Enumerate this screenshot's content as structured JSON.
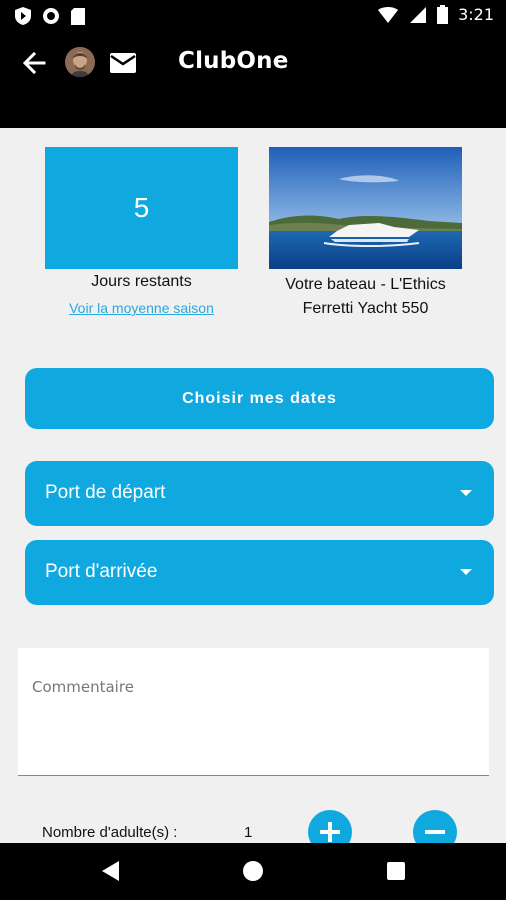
{
  "status_bar": {
    "time": "3:21",
    "icons": [
      "shield-app-icon",
      "record-icon",
      "sd-card-icon",
      "wifi-icon",
      "signal-icon",
      "battery-icon"
    ]
  },
  "app_bar": {
    "title": "ClubOne",
    "icons": [
      "back-arrow-icon",
      "avatar",
      "mail-icon"
    ]
  },
  "summary": {
    "days_remaining": "5",
    "days_label": "Jours restants",
    "season_link": "Voir la moyenne saison",
    "boat_label_line1": "Votre bateau - L'Ethics",
    "boat_label_line2": "Ferretti Yacht 550"
  },
  "actions": {
    "choose_dates": "Choisir mes dates"
  },
  "selects": {
    "departure_port": "Port de départ",
    "arrival_port": "Port d'arrivée"
  },
  "comment": {
    "placeholder": "Commentaire"
  },
  "adults": {
    "label": "Nombre d'adulte(s) :",
    "count": "1"
  },
  "colors": {
    "accent": "#0fa8df",
    "link": "#29a7de",
    "bars": "#000000",
    "background": "#f0f0f0"
  }
}
